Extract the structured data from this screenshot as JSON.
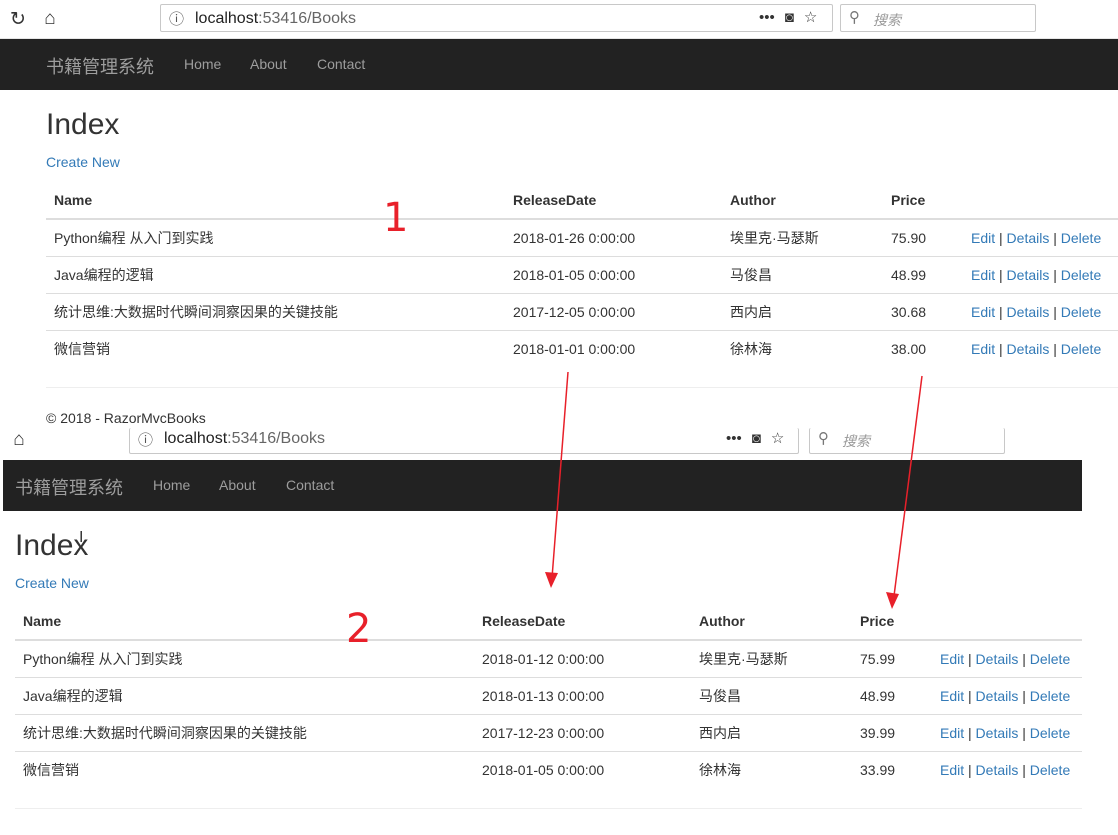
{
  "browser": {
    "url_host": "localhost",
    "url_path": ":53416/Books",
    "search_placeholder": "搜索"
  },
  "navbar": {
    "brand": "书籍管理系统",
    "links": [
      "Home",
      "About",
      "Contact"
    ]
  },
  "page": {
    "title": "Index",
    "create_link": "Create New",
    "columns": [
      "Name",
      "ReleaseDate",
      "Author",
      "Price"
    ],
    "actions": {
      "edit": "Edit",
      "details": "Details",
      "delete": "Delete",
      "sep": "|"
    },
    "footer": "© 2018 - RazorMvcBooks"
  },
  "screens": [
    {
      "marker": "1",
      "rows": [
        {
          "name": "Python编程 从入门到实践",
          "release": "2018-01-26 0:00:00",
          "author": "埃里克·马瑟斯",
          "price": "75.90"
        },
        {
          "name": "Java编程的逻辑",
          "release": "2018-01-05 0:00:00",
          "author": "马俊昌",
          "price": "48.99"
        },
        {
          "name": "统计思维:大数据时代瞬间洞察因果的关键技能",
          "release": "2017-12-05 0:00:00",
          "author": "西内启",
          "price": "30.68"
        },
        {
          "name": "微信营销",
          "release": "2018-01-01 0:00:00",
          "author": "徐林海",
          "price": "38.00"
        }
      ]
    },
    {
      "marker": "2",
      "rows": [
        {
          "name": "Python编程 从入门到实践",
          "release": "2018-01-12 0:00:00",
          "author": "埃里克·马瑟斯",
          "price": "75.99"
        },
        {
          "name": "Java编程的逻辑",
          "release": "2018-01-13 0:00:00",
          "author": "马俊昌",
          "price": "48.99"
        },
        {
          "name": "统计思维:大数据时代瞬间洞察因果的关键技能",
          "release": "2017-12-23 0:00:00",
          "author": "西内启",
          "price": "39.99"
        },
        {
          "name": "微信营销",
          "release": "2018-01-05 0:00:00",
          "author": "徐林海",
          "price": "33.99"
        }
      ]
    }
  ],
  "colors": {
    "navbar_bg": "#222222",
    "nav_text": "#9d9d9d",
    "link": "#337ab7",
    "annotation": "#e8202a"
  },
  "icons": [
    "reload-icon",
    "home-icon",
    "info-icon",
    "more-icon",
    "pocket-icon",
    "star-icon",
    "search-icon",
    "text-cursor-icon"
  ]
}
